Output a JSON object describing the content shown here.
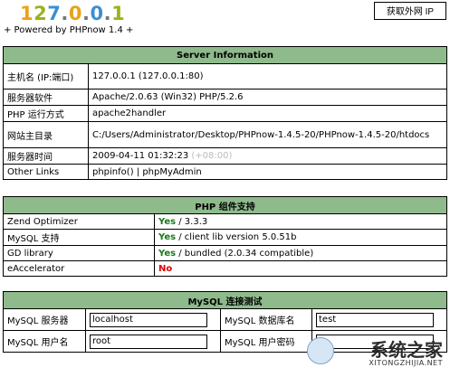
{
  "header": {
    "logo_chars": [
      "1",
      "2",
      "7",
      ".",
      "0",
      ".",
      "0",
      ".",
      "1"
    ],
    "logo_colors": [
      "#e8a317",
      "#9ab31b",
      "#3d8fd1",
      "#777777",
      "#e8a317",
      "#777777",
      "#3d8fd1",
      "#777777",
      "#9ab31b"
    ],
    "tagline": "+ Powered by PHPnow 1.4 +",
    "external_ip_button": "获取外网 IP"
  },
  "server_info": {
    "title": "Server Information",
    "rows": [
      {
        "label": "主机名 (IP:端口)",
        "value": "127.0.0.1 (127.0.0.1:80)"
      },
      {
        "label": "服务器软件",
        "value": "Apache/2.0.63 (Win32) PHP/5.2.6"
      },
      {
        "label": "PHP 运行方式",
        "value": "apache2handler"
      },
      {
        "label": "网站主目录",
        "value": "C:/Users/Administrator/Desktop/PHPnow-1.4.5-20/PHPnow-1.4.5-20/htdocs"
      },
      {
        "label": "服务器时间",
        "value": "2009-04-11 01:32:23",
        "extra": "(+08:00)"
      },
      {
        "label": "Other Links",
        "value": "phpinfo() | phpMyAdmin"
      }
    ]
  },
  "php_components": {
    "title": "PHP 组件支持",
    "rows": [
      {
        "label": "Zend Optimizer",
        "status": "Yes",
        "detail": " / 3.3.3"
      },
      {
        "label": "MySQL 支持",
        "status": "Yes",
        "detail": " / client lib version 5.0.51b"
      },
      {
        "label": "GD library",
        "status": "Yes",
        "detail": " / bundled (2.0.34 compatible)"
      },
      {
        "label": "eAccelerator",
        "status": "No",
        "detail": ""
      }
    ]
  },
  "mysql_test": {
    "title": "MySQL 连接测试",
    "server_label": "MySQL 服务器",
    "server_value": "localhost",
    "db_label": "MySQL 数据库名",
    "db_value": "test",
    "user_label": "MySQL 用户名",
    "user_value": "root",
    "password_label": "MySQL 用户密码",
    "password_value": ""
  },
  "watermark": {
    "text": "系统之家",
    "url": "XITONGZHIJIA.NET"
  }
}
